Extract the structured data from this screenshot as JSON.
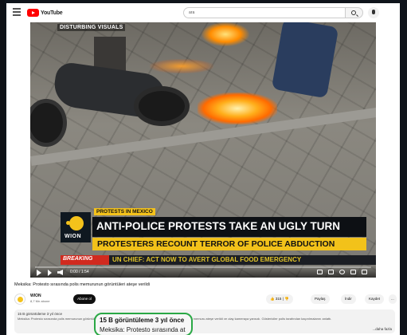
{
  "header": {
    "logo_text": "YouTube",
    "search_value": "ara"
  },
  "video": {
    "overlay_tag": "DISTURBING VISUALS",
    "kicker": "PROTESTS IN MEXICO",
    "logo_text": "WION",
    "headline": "ANTI-POLICE PROTESTS TAKE AN UGLY TURN",
    "subheadline": "PROTESTERS RECOUNT TERROR OF POLICE ABDUCTION",
    "ticker_label": "BREAKING",
    "ticker_text": "UN CHIEF: ACT NOW TO AVERT GLOBAL FOOD EMERGENCY",
    "time": "0:00 / 1:54",
    "progress": 0.0
  },
  "info": {
    "title": "Meksika: Protesto sırasında polis memurunun görüntüleri ateşe verildi",
    "channel_name": "WION",
    "channel_subs": "8,7 Mn abone",
    "subscribe_label": "Abone ol",
    "like_label": "315",
    "share_label": "Paylaş",
    "download_label": "İndir",
    "clip_label": "Kaydet",
    "more_label": "..."
  },
  "description": {
    "meta_small": "15 B görüntüleme  3 yıl önce",
    "text_small": "Meksika: Protesto sırasında polis memurunun görüntüleri ateşe verildi. Meksika'da polise karşı protestolar sırasında bir polis memuru ateşe verildi ve olay kameraya yansıdı. Göstericiler polis tarafından kaçırılmalarını anlattı.",
    "more": "...daha fazla"
  },
  "callout": {
    "meta": "15 B görüntüleme  3 yıl önce",
    "text": "Meksika: Protesto sırasında at"
  }
}
